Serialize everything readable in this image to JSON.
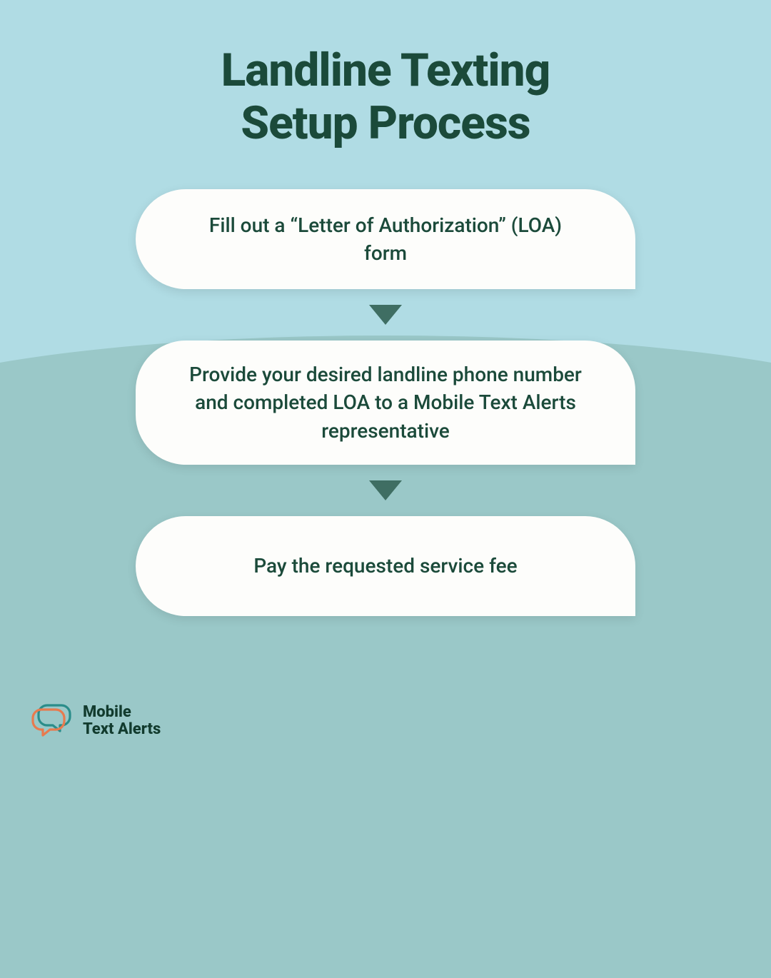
{
  "title_line1": "Landline Texting",
  "title_line2": "Setup Process",
  "steps": [
    {
      "text": "Fill out a “Letter of Authorization” (LOA) form"
    },
    {
      "text": "Provide your desired landline phone number and completed LOA to a Mobile Text Alerts representative"
    },
    {
      "text": "Pay the requested service fee"
    }
  ],
  "logo": {
    "line1": "Mobile",
    "line2": "Text Alerts"
  },
  "colors": {
    "text": "#1b4a3a",
    "bgTop": "#b0dce4",
    "bgBottom": "#9ac8c8",
    "bubble": "#fdfdfb",
    "arrow": "#3f6e63",
    "logoOrange": "#e87a4e",
    "logoTeal": "#2a8d8a"
  }
}
